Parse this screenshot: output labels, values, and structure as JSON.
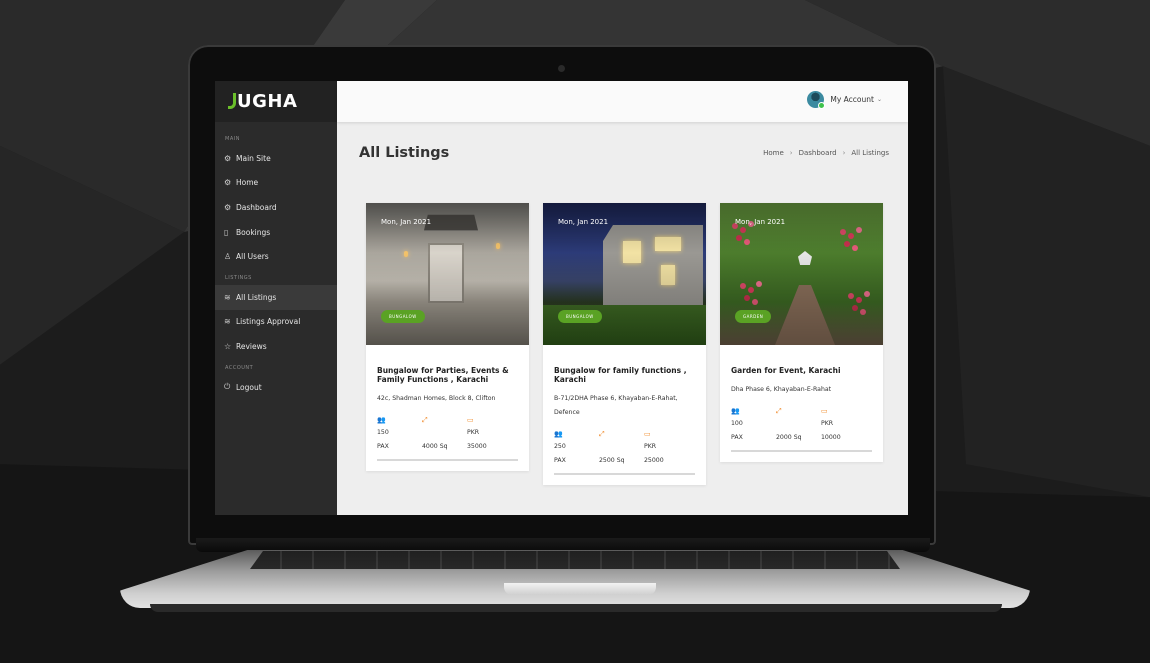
{
  "brand": {
    "name": "UGHA",
    "accent": "#6bbf2a"
  },
  "sidebar": {
    "sections": [
      {
        "label": "MAIN"
      },
      {
        "label": "LISTINGS"
      },
      {
        "label": "ACCOUNT"
      }
    ],
    "items": [
      {
        "label": "Main Site",
        "icon": "gear-icon"
      },
      {
        "label": "Home",
        "icon": "gear-icon"
      },
      {
        "label": "Dashboard",
        "icon": "gear-icon"
      },
      {
        "label": "Bookings",
        "icon": "book-icon"
      },
      {
        "label": "All Users",
        "icon": "user-icon"
      },
      {
        "label": "All Listings",
        "icon": "layers-icon",
        "active": true
      },
      {
        "label": "Listings Approval",
        "icon": "layers-icon"
      },
      {
        "label": "Reviews",
        "icon": "star-icon"
      },
      {
        "label": "Logout",
        "icon": "power-icon"
      }
    ]
  },
  "topbar": {
    "account_label": "My Account",
    "status_color": "#3ec24c"
  },
  "page": {
    "title": "All Listings",
    "breadcrumb": [
      "Home",
      "Dashboard",
      "All Listings"
    ]
  },
  "listings": [
    {
      "date": "Mon, Jan 2021",
      "tag": "BUNGALOW",
      "title": "Bungalow for Parties, Events & Family Functions , Karachi",
      "address": "42c, Shadman Homes, Block 8, Clifton",
      "pax": "150",
      "pax_unit": "PAX",
      "area": "4000 Sq",
      "currency": "PKR",
      "price": "35000"
    },
    {
      "date": "Mon, Jan 2021",
      "tag": "BUNGALOW",
      "title": "Bungalow for family functions , Karachi",
      "address": "B-71/2DHA Phase 6, Khayaban-E-Rahat, Defence",
      "pax": "250",
      "pax_unit": "PAX",
      "area": "2500 Sq",
      "currency": "PKR",
      "price": "25000"
    },
    {
      "date": "Mon, Jan 2021",
      "tag": "GARDEN",
      "title": "Garden for Event, Karachi",
      "address": "Dha Phase 6, Khayaban-E-Rahat",
      "pax": "100",
      "pax_unit": "PAX",
      "area": "2000 Sq",
      "currency": "PKR",
      "price": "10000"
    }
  ],
  "colors": {
    "tag": "#5aa224",
    "stat_icon": "#f08a2a",
    "sidebar": "#2b2b2b"
  }
}
